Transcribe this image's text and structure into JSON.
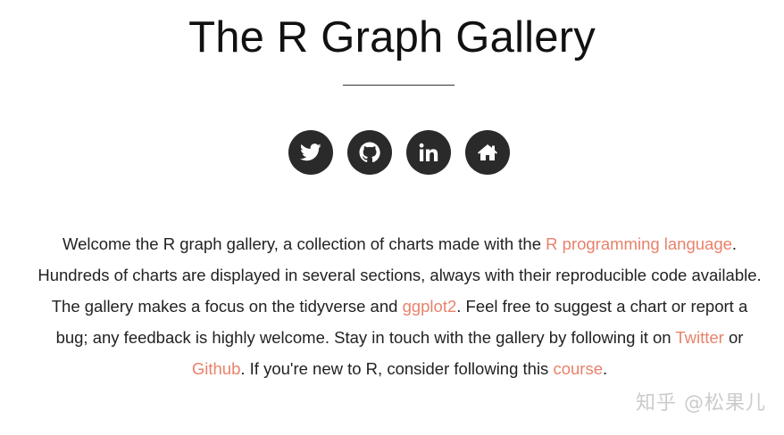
{
  "header": {
    "title": "The R Graph Gallery"
  },
  "social": [
    {
      "name": "twitter-icon",
      "label": "Twitter"
    },
    {
      "name": "github-icon",
      "label": "Github"
    },
    {
      "name": "linkedin-icon",
      "label": "LinkedIn"
    },
    {
      "name": "home-icon",
      "label": "Home"
    }
  ],
  "colors": {
    "link": "#e8826b",
    "icon_bg": "#2a2a2a",
    "text": "#222222"
  },
  "intro": {
    "t1": "Welcome the R graph gallery, a collection of charts made with the ",
    "link_r_language": "R programming language",
    "t2": ". Hundreds of charts are displayed in several sections, always with their reproducible code available. The gallery makes a focus on the tidyverse and ",
    "link_ggplot2": "ggplot2",
    "t3": ". Feel free to suggest a chart or report a bug; any feedback is highly welcome. Stay in touch with the gallery by following it on ",
    "link_twitter": "Twitter",
    "t4": " or ",
    "link_github": "Github",
    "t5": ". If you're new to R, consider following this ",
    "link_course": "course",
    "t6": "."
  },
  "watermark": "知乎 @松果儿"
}
